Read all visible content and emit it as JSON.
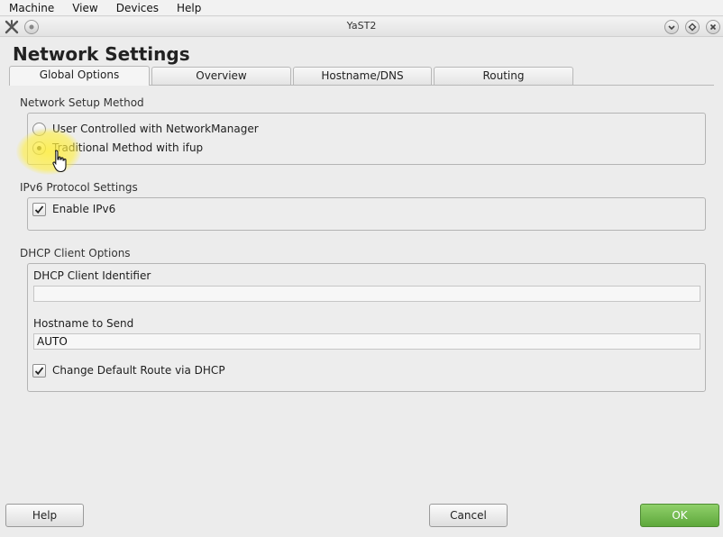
{
  "menubar": {
    "items": [
      "Machine",
      "View",
      "Devices",
      "Help"
    ]
  },
  "window": {
    "title": "YaST2"
  },
  "page": {
    "title": "Network Settings"
  },
  "tabs": [
    {
      "label": "Global Options",
      "active": true
    },
    {
      "label": "Overview",
      "active": false
    },
    {
      "label": "Hostname/DNS",
      "active": false
    },
    {
      "label": "Routing",
      "active": false
    }
  ],
  "setup_method": {
    "label": "Network Setup Method",
    "options": [
      {
        "label": "User Controlled with NetworkManager",
        "selected": false
      },
      {
        "label": "Traditional Method with ifup",
        "selected": true
      }
    ]
  },
  "ipv6": {
    "label": "IPv6 Protocol Settings",
    "enable": {
      "label": "Enable IPv6",
      "checked": true
    }
  },
  "dhcp": {
    "label": "DHCP Client Options",
    "client_identifier": {
      "label": "DHCP Client Identifier",
      "value": ""
    },
    "hostname_to_send": {
      "label": "Hostname to Send",
      "value": "AUTO"
    },
    "change_default_route": {
      "label": "Change Default Route via DHCP",
      "checked": true
    }
  },
  "buttons": {
    "help": "Help",
    "cancel": "Cancel",
    "ok": "OK"
  },
  "colors": {
    "ok_button": "#6db84a",
    "highlight": "#ffee3c"
  },
  "icons": {
    "window_logo": "yast-logo-icon",
    "window_menu": "window-menu-icon",
    "minimize": "minimize-icon",
    "maximize": "maximize-icon",
    "close": "close-icon"
  }
}
